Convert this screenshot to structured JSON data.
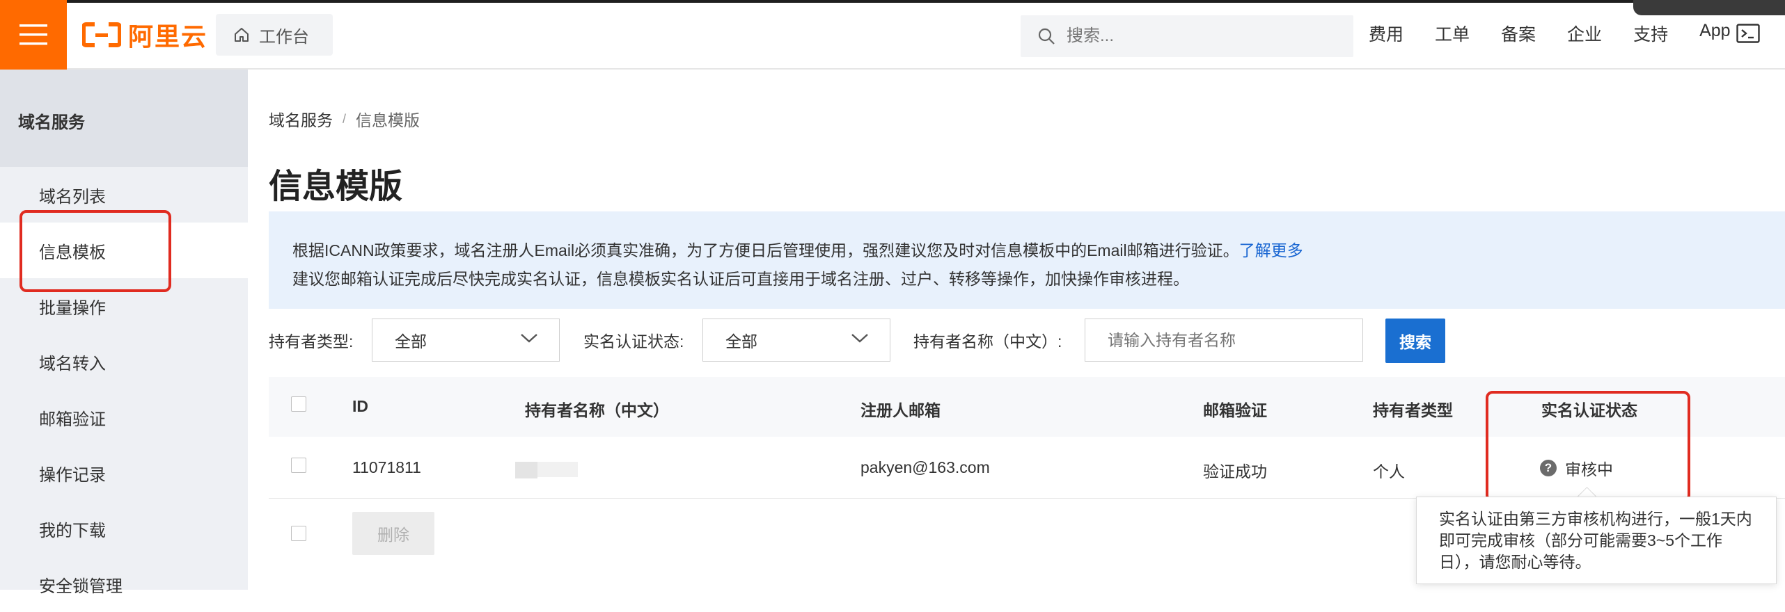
{
  "topbar": {
    "logo_text": "阿里云",
    "workbench_label": "工作台",
    "search_placeholder": "搜索...",
    "nav": [
      "费用",
      "工单",
      "备案",
      "企业",
      "支持",
      "App"
    ]
  },
  "sidebar": {
    "title": "域名服务",
    "items": [
      {
        "label": "域名列表",
        "active": false
      },
      {
        "label": "信息模板",
        "active": true
      },
      {
        "label": "批量操作",
        "active": false
      },
      {
        "label": "域名转入",
        "active": false
      },
      {
        "label": "邮箱验证",
        "active": false
      },
      {
        "label": "操作记录",
        "active": false
      },
      {
        "label": "我的下载",
        "active": false
      },
      {
        "label": "安全锁管理",
        "active": false
      }
    ]
  },
  "breadcrumb": {
    "root": "域名服务",
    "separator": "/",
    "current": "信息模版"
  },
  "page_title": "信息模版",
  "notice": {
    "line1": "根据ICANN政策要求，域名注册人Email必须真实准确，为了方便日后管理使用，强烈建议您及时对信息模板中的Email邮箱进行验证。",
    "link": "了解更多",
    "line2": "建议您邮箱认证完成后尽快完成实名认证，信息模板实名认证后可直接用于域名注册、过户、转移等操作，加快操作审核进程。"
  },
  "filters": {
    "holder_type_label": "持有者类型:",
    "holder_type_value": "全部",
    "verify_status_label": "实名认证状态:",
    "verify_status_value": "全部",
    "holder_name_label": "持有者名称（中文）:",
    "holder_name_placeholder": "请输入持有者名称",
    "search_button": "搜索"
  },
  "table": {
    "columns": [
      "ID",
      "持有者名称（中文）",
      "注册人邮箱",
      "邮箱验证",
      "持有者类型",
      "实名认证状态"
    ],
    "rows": [
      {
        "id": "11071811",
        "email": "pakyen@163.com",
        "email_verified": "验证成功",
        "holder_type": "个人",
        "status": "审核中"
      }
    ],
    "delete_button": "删除"
  },
  "tooltip": {
    "text": "实名认证由第三方审核机构进行，一般1天内即可完成审核（部分可能需要3~5个工作日），请您耐心等待。"
  },
  "colors": {
    "brand": "#ff6a00",
    "primary": "#1a6fd1",
    "highlight": "#e02b20",
    "notice_bg": "#e8f1fc"
  }
}
